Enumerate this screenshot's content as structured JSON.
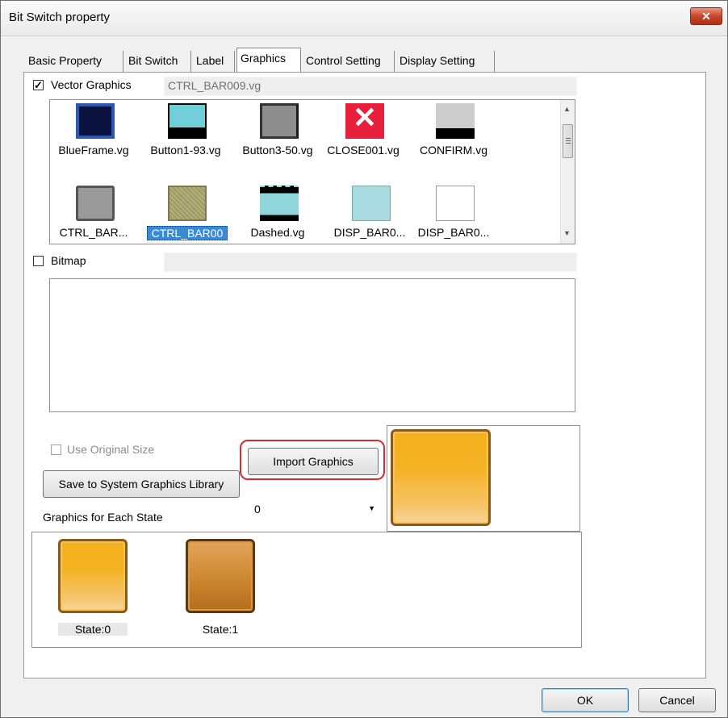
{
  "window": {
    "title": "Bit Switch property",
    "close_label": "✕"
  },
  "tabs": [
    {
      "label": "Basic Property"
    },
    {
      "label": "Bit Switch"
    },
    {
      "label": "Label"
    },
    {
      "label": "Graphics"
    },
    {
      "label": "Control Setting"
    },
    {
      "label": "Display Setting"
    }
  ],
  "vector": {
    "label": "Vector Graphics",
    "checked_mark": "✓",
    "file": "CTRL_BAR009.vg",
    "items": [
      {
        "caption": "BlueFrame.vg"
      },
      {
        "caption": "Button1-93.vg"
      },
      {
        "caption": "Button3-50.vg"
      },
      {
        "caption": "CLOSE001.vg"
      },
      {
        "caption": "CONFIRM.vg"
      },
      {
        "caption": "CTRL_BAR..."
      },
      {
        "caption": "CTRL_BAR00"
      },
      {
        "caption": "Dashed.vg"
      },
      {
        "caption": "DISP_BAR0..."
      },
      {
        "caption": "DISP_BAR0..."
      }
    ],
    "selected_index": 6
  },
  "bitmap": {
    "label": "Bitmap",
    "file": ""
  },
  "use_original_size": {
    "label": "Use Original Size"
  },
  "buttons": {
    "import": "Import Graphics",
    "save": "Save to System Graphics Library",
    "ok": "OK",
    "cancel": "Cancel"
  },
  "states": {
    "label": "Graphics for Each State",
    "selected_value": "0",
    "items": [
      {
        "caption": "State:0"
      },
      {
        "caption": "State:1"
      }
    ]
  },
  "colors": {
    "selection": "#3a8ad8",
    "highlight": "#d92b2b",
    "gold": "#f5b21e",
    "close_red": "#c7462c"
  }
}
